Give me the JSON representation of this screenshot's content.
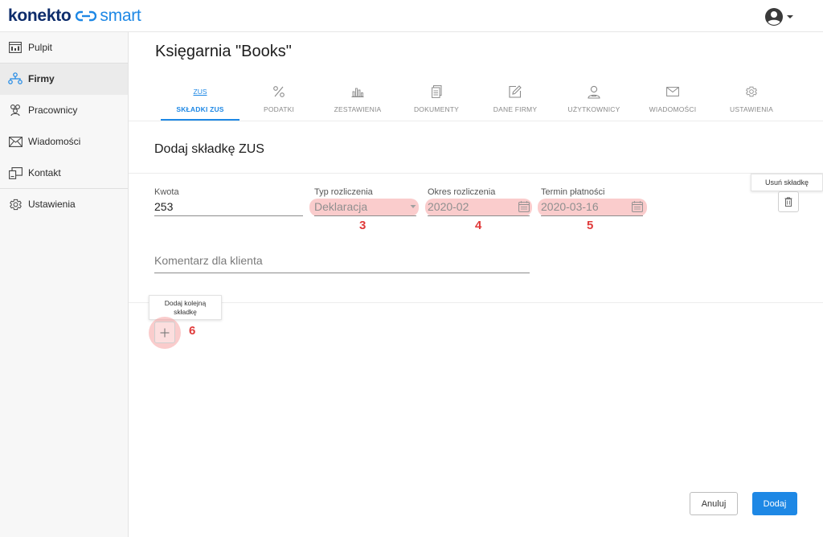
{
  "app": {
    "logo_left": "konekto",
    "logo_right": "smart",
    "accent_color": "#1e88e5",
    "brand_color": "#0d2c6b",
    "user_icon": "account-circle-icon"
  },
  "sidebar": {
    "items": [
      {
        "label": "Pulpit",
        "icon": "dashboard-icon"
      },
      {
        "label": "Firmy",
        "icon": "companies-icon",
        "active": true
      },
      {
        "label": "Pracownicy",
        "icon": "employees-icon"
      },
      {
        "label": "Wiadomości",
        "icon": "mail-icon"
      },
      {
        "label": "Kontakt",
        "icon": "contact-icon"
      },
      {
        "label": "Ustawienia",
        "icon": "gear-icon"
      }
    ]
  },
  "main": {
    "company_title": "Księgarnia \"Books\"",
    "tabs": [
      {
        "label": "SKŁADKI ZUS",
        "icon_text": "ZUS",
        "active": true
      },
      {
        "label": "PODATKI",
        "icon": "percent-icon"
      },
      {
        "label": "ZESTAWIENIA",
        "icon": "bar-chart-icon"
      },
      {
        "label": "DOKUMENTY",
        "icon": "documents-icon"
      },
      {
        "label": "DANE FIRMY",
        "icon": "edit-icon"
      },
      {
        "label": "UŻYTKOWNICY",
        "icon": "user-icon"
      },
      {
        "label": "WIADOMOŚCI",
        "icon": "mail-icon"
      },
      {
        "label": "USTAWIENIA",
        "icon": "gear-icon"
      }
    ],
    "section_title": "Dodaj składkę ZUS"
  },
  "form": {
    "amount": {
      "label": "Kwota",
      "value": "253"
    },
    "settlement_type": {
      "label": "Typ rozliczenia",
      "value": "Deklaracja"
    },
    "period": {
      "label": "Okres rozliczenia",
      "value": "2020-02"
    },
    "due_date": {
      "label": "Termin płatności",
      "value": "2020-03-16"
    },
    "comment": {
      "placeholder": "Komentarz dla klienta"
    },
    "delete_tooltip": "Usuń składkę",
    "add_tooltip": "Dodaj kolejną składkę",
    "annotations": [
      "3",
      "4",
      "5",
      "6"
    ]
  },
  "actions": {
    "cancel": "Anuluj",
    "submit": "Dodaj"
  }
}
